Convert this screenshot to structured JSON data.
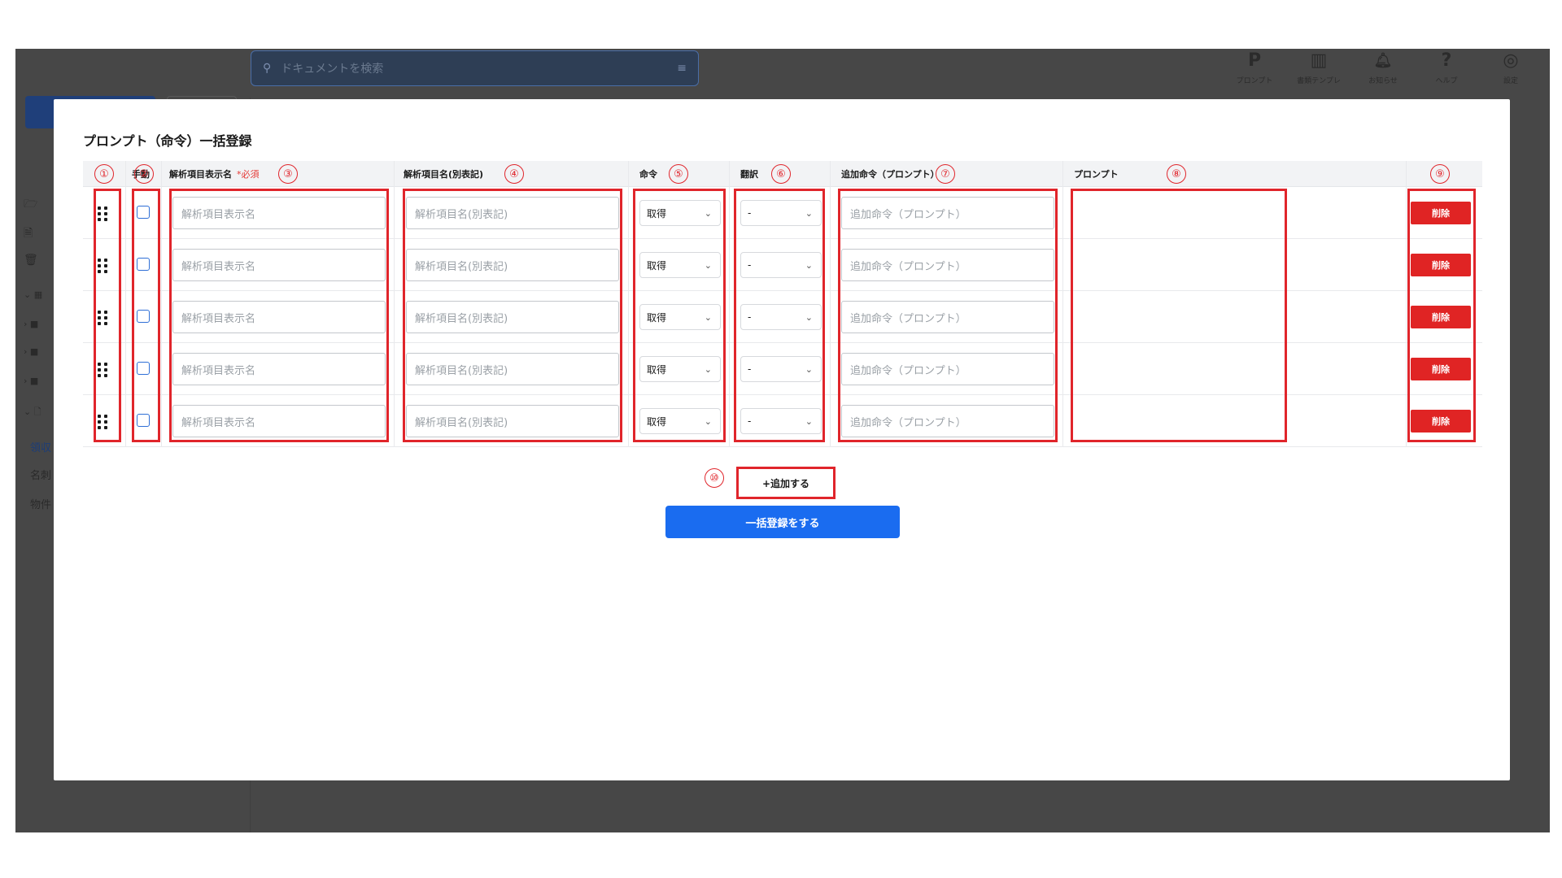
{
  "background": {
    "search_placeholder": "ドキュメントを検索",
    "top_nav": [
      {
        "icon": "p-logo-icon",
        "glyph": "P",
        "label": "プロンプト"
      },
      {
        "icon": "template-icon",
        "glyph": "▥",
        "label": "書類テンプレ"
      },
      {
        "icon": "bell-icon",
        "glyph": "🔔︎",
        "label": "お知らせ"
      },
      {
        "icon": "help-icon",
        "glyph": "?",
        "label": "ヘルプ"
      },
      {
        "icon": "settings-user-icon",
        "glyph": "◎",
        "label": "設定"
      }
    ],
    "sidebar_items": [
      "領収",
      "名刺",
      "物件"
    ]
  },
  "modal": {
    "title": "プロンプト（命令）一括登録",
    "columns": {
      "manual": "手動",
      "display_name": "解析項目表示名",
      "required": "*必須",
      "alias": "解析項目名(別表記)",
      "command": "命令",
      "translation": "翻訳",
      "extra_prompt": "追加命令（プロンプト）",
      "prompt": "プロンプト"
    },
    "rows": [
      {
        "display_name_ph": "解析項目表示名",
        "alias_ph": "解析項目名(別表記)",
        "command": "取得",
        "translation": "-",
        "extra_ph": "追加命令（プロンプト）",
        "delete": "削除"
      },
      {
        "display_name_ph": "解析項目表示名",
        "alias_ph": "解析項目名(別表記)",
        "command": "取得",
        "translation": "-",
        "extra_ph": "追加命令（プロンプト）",
        "delete": "削除"
      },
      {
        "display_name_ph": "解析項目表示名",
        "alias_ph": "解析項目名(別表記)",
        "command": "取得",
        "translation": "-",
        "extra_ph": "追加命令（プロンプト）",
        "delete": "削除"
      },
      {
        "display_name_ph": "解析項目表示名",
        "alias_ph": "解析項目名(別表記)",
        "command": "取得",
        "translation": "-",
        "extra_ph": "追加命令（プロンプト）",
        "delete": "削除"
      },
      {
        "display_name_ph": "解析項目表示名",
        "alias_ph": "解析項目名(別表記)",
        "command": "取得",
        "translation": "-",
        "extra_ph": "追加命令（プロンプト）",
        "delete": "削除"
      }
    ],
    "add_label": "+追加する",
    "bulk_register_label": "一括登録をする"
  },
  "annotations": [
    "①",
    "②",
    "③",
    "④",
    "⑤",
    "⑥",
    "⑦",
    "⑧",
    "⑨",
    "⑩"
  ],
  "colors": {
    "annotation": "#e0252b",
    "primary": "#1a6cf0",
    "danger": "#e02424"
  }
}
